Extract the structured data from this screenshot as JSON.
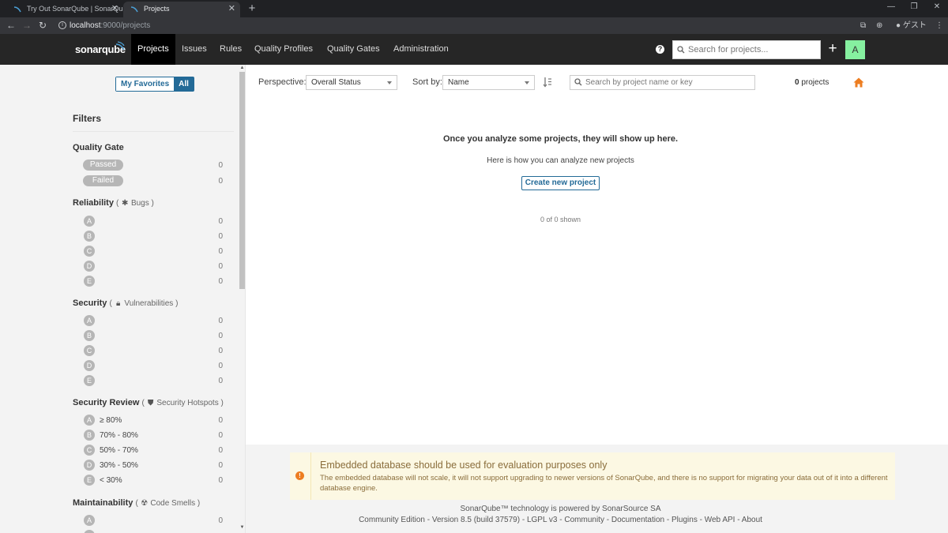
{
  "browser": {
    "tabs": [
      {
        "title": "Try Out SonarQube | SonarQube"
      },
      {
        "title": "Projects"
      }
    ],
    "url_host": "localhost",
    "url_path": ":9000/projects",
    "profile_label": "ゲスト"
  },
  "nav": {
    "logo": "sonarqube",
    "items": [
      "Projects",
      "Issues",
      "Rules",
      "Quality Profiles",
      "Quality Gates",
      "Administration"
    ],
    "search_placeholder": "Search for projects...",
    "avatar_letter": "A"
  },
  "sidebar": {
    "toggle": {
      "favorites": "My Favorites",
      "all": "All"
    },
    "filters_title": "Filters",
    "quality_gate": {
      "title": "Quality Gate",
      "options": [
        {
          "label": "Passed",
          "count": "0"
        },
        {
          "label": "Failed",
          "count": "0"
        }
      ]
    },
    "reliability": {
      "title": "Reliability",
      "paren_open": "(",
      "sub": "Bugs",
      "paren_close": ")",
      "grades": [
        {
          "g": "A",
          "c": "0"
        },
        {
          "g": "B",
          "c": "0"
        },
        {
          "g": "C",
          "c": "0"
        },
        {
          "g": "D",
          "c": "0"
        },
        {
          "g": "E",
          "c": "0"
        }
      ]
    },
    "security": {
      "title": "Security",
      "paren_open": "(",
      "sub": "Vulnerabilities",
      "paren_close": ")",
      "grades": [
        {
          "g": "A",
          "c": "0"
        },
        {
          "g": "B",
          "c": "0"
        },
        {
          "g": "C",
          "c": "0"
        },
        {
          "g": "D",
          "c": "0"
        },
        {
          "g": "E",
          "c": "0"
        }
      ]
    },
    "security_review": {
      "title": "Security Review",
      "paren_open": "(",
      "sub": "Security Hotspots",
      "paren_close": ")",
      "grades": [
        {
          "g": "A",
          "r": "≥ 80%",
          "c": "0"
        },
        {
          "g": "B",
          "r": "70% - 80%",
          "c": "0"
        },
        {
          "g": "C",
          "r": "50% - 70%",
          "c": "0"
        },
        {
          "g": "D",
          "r": "30% - 50%",
          "c": "0"
        },
        {
          "g": "E",
          "r": "< 30%",
          "c": "0"
        }
      ]
    },
    "maintainability": {
      "title": "Maintainability",
      "paren_open": "(",
      "sub": "Code Smells",
      "paren_close": ")",
      "grades": [
        {
          "g": "A",
          "c": "0"
        }
      ]
    }
  },
  "toolbar": {
    "perspective_label": "Perspective:",
    "perspective_value": "Overall Status",
    "sort_label": "Sort by:",
    "sort_value": "Name",
    "search_placeholder": "Search by project name or key",
    "project_count": "0",
    "project_count_label": "projects"
  },
  "empty": {
    "title": "Once you analyze some projects, they will show up here.",
    "subtitle": "Here is how you can analyze new projects",
    "create_button": "Create new project",
    "shown": "0 of 0 shown"
  },
  "warning": {
    "title": "Embedded database should be used for evaluation purposes only",
    "body": "The embedded database will not scale, it will not support upgrading to newer versions of SonarQube, and there is no support for migrating your data out of it into a different database engine."
  },
  "footer": {
    "line1": "SonarQube™ technology is powered by SonarSource SA",
    "edition": "Community Edition",
    "version": "Version 8.5 (build 37579)",
    "license": "LGPL v3",
    "links": [
      "Community",
      "Documentation",
      "Plugins",
      "Web API",
      "About"
    ],
    "separator": " - "
  },
  "colors": {
    "accent": "#236a97",
    "nav_bg": "#262626",
    "avatar_bg": "#86f0a0",
    "warning_bg": "#fcf8e3",
    "warning_icon": "#ed7d20",
    "home_icon": "#ed7d20"
  },
  "icons": {
    "help": "help-icon",
    "search": "search-icon",
    "plus": "plus-icon",
    "bug": "bug-icon",
    "lock": "lock-icon",
    "shield": "shield-icon",
    "smell": "code-smell-icon",
    "home": "home-icon",
    "sort": "sort-icon",
    "warning": "warning-icon"
  }
}
